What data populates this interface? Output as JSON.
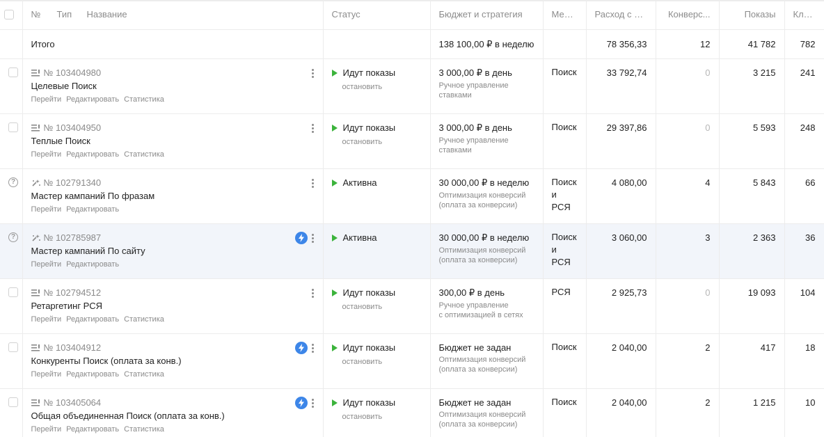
{
  "header": {
    "num": "№",
    "type": "Тип",
    "name": "Название",
    "status": "Статус",
    "budget": "Бюджет и стратегия",
    "places": "Места",
    "spend": "Расход с Н...",
    "conversions": "Конверс...",
    "impressions": "Показы",
    "clicks": "Клики"
  },
  "total": {
    "label": "Итого",
    "budget": "138 100,00 ₽ в неделю",
    "spend": "78 356,33",
    "conversions": "12",
    "impressions": "41 782",
    "clicks": "782"
  },
  "campaigns": [
    {
      "id": "№ 103404980",
      "type_icon": "text-campaign-icon",
      "title": "Целевые Поиск",
      "actions": [
        "Перейти",
        "Редактировать",
        "Статистика"
      ],
      "status": "Идут показы",
      "stop": "остановить",
      "budget": "3 000,00 ₽ в день",
      "strategy": "Ручное управление\nставками",
      "places": "Поиск",
      "spend": "33 792,74",
      "conversions": "0",
      "impressions": "3 215",
      "clicks": "241"
    },
    {
      "id": "№ 103404950",
      "type_icon": "text-campaign-icon",
      "title": "Теплые Поиск",
      "actions": [
        "Перейти",
        "Редактировать",
        "Статистика"
      ],
      "status": "Идут показы",
      "stop": "остановить",
      "budget": "3 000,00 ₽ в день",
      "strategy": "Ручное управление\nставками",
      "places": "Поиск",
      "spend": "29 397,86",
      "conversions": "0",
      "impressions": "5 593",
      "clicks": "248"
    },
    {
      "id": "№ 102791340",
      "type_icon": "master-campaign-icon",
      "title": "Мастер кампаний По фразам",
      "actions": [
        "Перейти",
        "Редактировать"
      ],
      "status": "Активна",
      "stop": "",
      "budget": "30 000,00 ₽ в неделю",
      "strategy": "Оптимизация конверсий\n(оплата за конверсии)",
      "places": "Поиск\nи РСЯ",
      "spend": "4 080,00",
      "conversions": "4",
      "impressions": "5 843",
      "clicks": "66"
    },
    {
      "id": "№ 102785987",
      "type_icon": "master-campaign-icon",
      "title": "Мастер кампаний По сайту",
      "actions": [
        "Перейти",
        "Редактировать"
      ],
      "status": "Активна",
      "stop": "",
      "budget": "30 000,00 ₽ в неделю",
      "strategy": "Оптимизация конверсий\n(оплата за конверсии)",
      "places": "Поиск\nи РСЯ",
      "spend": "3 060,00",
      "conversions": "3",
      "impressions": "2 363",
      "clicks": "36"
    },
    {
      "id": "№ 102794512",
      "type_icon": "text-campaign-icon",
      "title": "Ретаргетинг РСЯ",
      "actions": [
        "Перейти",
        "Редактировать",
        "Статистика"
      ],
      "status": "Идут показы",
      "stop": "остановить",
      "budget": "300,00 ₽ в день",
      "strategy": "Ручное управление\nс оптимизацией в сетях",
      "places": "РСЯ",
      "spend": "2 925,73",
      "conversions": "0",
      "impressions": "19 093",
      "clicks": "104"
    },
    {
      "id": "№ 103404912",
      "type_icon": "text-campaign-icon",
      "title": "Конкуренты Поиск (оплата за конв.)",
      "actions": [
        "Перейти",
        "Редактировать",
        "Статистика"
      ],
      "status": "Идут показы",
      "stop": "остановить",
      "budget": "Бюджет не задан",
      "strategy": "Оптимизация конверсий\n(оплата за конверсии)",
      "places": "Поиск",
      "spend": "2 040,00",
      "conversions": "2",
      "impressions": "417",
      "clicks": "18"
    },
    {
      "id": "№ 103405064",
      "type_icon": "text-campaign-icon",
      "title": "Общая объединенная Поиск (оплата за конв.)",
      "actions": [
        "Перейти",
        "Редактировать",
        "Статистика"
      ],
      "status": "Идут показы",
      "stop": "остановить",
      "budget": "Бюджет не задан",
      "strategy": "Оптимизация конверсий\n(оплата за конверсии)",
      "places": "Поиск",
      "spend": "2 040,00",
      "conversions": "2",
      "impressions": "1 215",
      "clicks": "10"
    }
  ],
  "colors": {
    "active_status": "#3bb33b",
    "bolt": "#3d86e8",
    "row_highlight": "#f2f5fa",
    "muted_text": "#8a8a8a"
  }
}
